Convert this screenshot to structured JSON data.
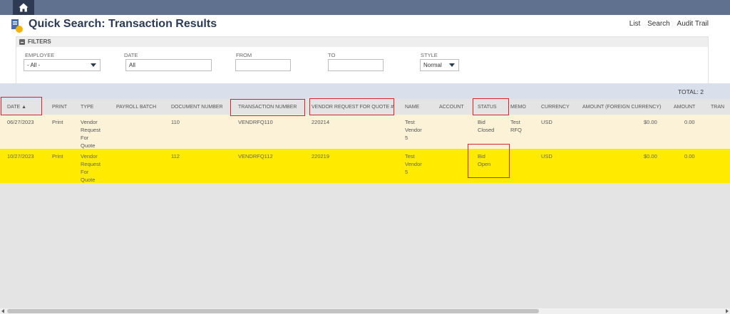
{
  "header": {
    "title": "Quick Search: Transaction Results",
    "links": [
      "List",
      "Search",
      "Audit Trail"
    ]
  },
  "filters": {
    "heading": "FILTERS",
    "employee": {
      "label": "EMPLOYEE",
      "value": "- All -"
    },
    "date": {
      "label": "DATE",
      "value": "All"
    },
    "from": {
      "label": "FROM",
      "value": ""
    },
    "to": {
      "label": "TO",
      "value": ""
    },
    "style": {
      "label": "STYLE",
      "value": "Normal"
    }
  },
  "results": {
    "total_label": "TOTAL: 2",
    "columns": [
      "DATE ▲",
      "PRINT",
      "TYPE",
      "PAYROLL BATCH",
      "DOCUMENT NUMBER",
      "TRANSACTION NUMBER",
      "VENDOR REQUEST FOR QUOTE #",
      "NAME",
      "ACCOUNT",
      "STATUS",
      "MEMO",
      "CURRENCY",
      "AMOUNT (FOREIGN CURRENCY)",
      "AMOUNT",
      "TRAN"
    ],
    "rows": [
      {
        "date": "06/27/2023",
        "print": "Print",
        "type": [
          "Vendor",
          "Request",
          "For",
          "Quote"
        ],
        "payroll_batch": "",
        "document_number": "110",
        "transaction_number": "VENDRFQ110",
        "vendor_rfq": "220214",
        "name": [
          "Test",
          "Vendor",
          "5"
        ],
        "account": "",
        "status": [
          "Bid",
          "Closed"
        ],
        "memo": [
          "Test",
          "RFQ"
        ],
        "currency": "USD",
        "amount_foreign": "$0.00",
        "amount": "0.00"
      },
      {
        "date": "10/27/2023",
        "print": "Print",
        "type": [
          "Vendor",
          "Request",
          "For",
          "Quote"
        ],
        "payroll_batch": "",
        "document_number": "112",
        "transaction_number": "VENDRFQ112",
        "vendor_rfq": "220219",
        "name": [
          "Test",
          "Vendor",
          "5"
        ],
        "account": "",
        "status": [
          "Bid",
          "Open"
        ],
        "memo": [
          "",
          ""
        ],
        "currency": "USD",
        "amount_foreign": "$0.00",
        "amount": "0.00"
      }
    ]
  },
  "colors": {
    "topbar": "#607190",
    "title": "#2b3a55",
    "row_highlight": "#ffea00",
    "row_normal": "#fcf2d8",
    "annotation_red": "#d9232a"
  },
  "icons": [
    "home-icon",
    "transaction-search-icon",
    "filters-collapse-icon",
    "dropdown-caret-icon",
    "scroll-left-icon",
    "scroll-right-icon"
  ]
}
